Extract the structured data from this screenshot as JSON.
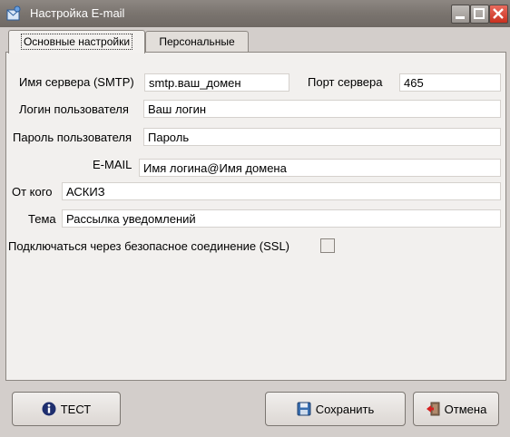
{
  "window": {
    "title": "Настройка E-mail",
    "icons": [
      "app-icon",
      "minimize-icon",
      "maximize-icon",
      "close-icon"
    ]
  },
  "tabs": [
    {
      "label": "Основные настройки",
      "active": true
    },
    {
      "label": "Персональные",
      "active": false
    }
  ],
  "form": {
    "server_label": "Имя сервера (SMTP)",
    "server_value": "smtp.ваш_домен",
    "port_label": "Порт сервера",
    "port_value": "465",
    "login_label": "Логин пользователя",
    "login_value": "Ваш логин",
    "password_label": "Пароль пользователя",
    "password_value": "Пароль",
    "email_label": "E-MAIL",
    "email_value": "Имя логина@Имя домена",
    "from_label": "От кого",
    "from_value": "АСКИЗ",
    "subject_label": "Тема",
    "subject_value": "Рассылка уведомлений",
    "ssl_label": "Подключаться через безопасное соединение (SSL)",
    "ssl_checked": false
  },
  "buttons": {
    "test_label": "ТЕСТ",
    "save_label": "Сохранить",
    "cancel_label": "Отмена",
    "icons": [
      "info-icon",
      "save-disk-icon",
      "exit-door-icon"
    ]
  }
}
